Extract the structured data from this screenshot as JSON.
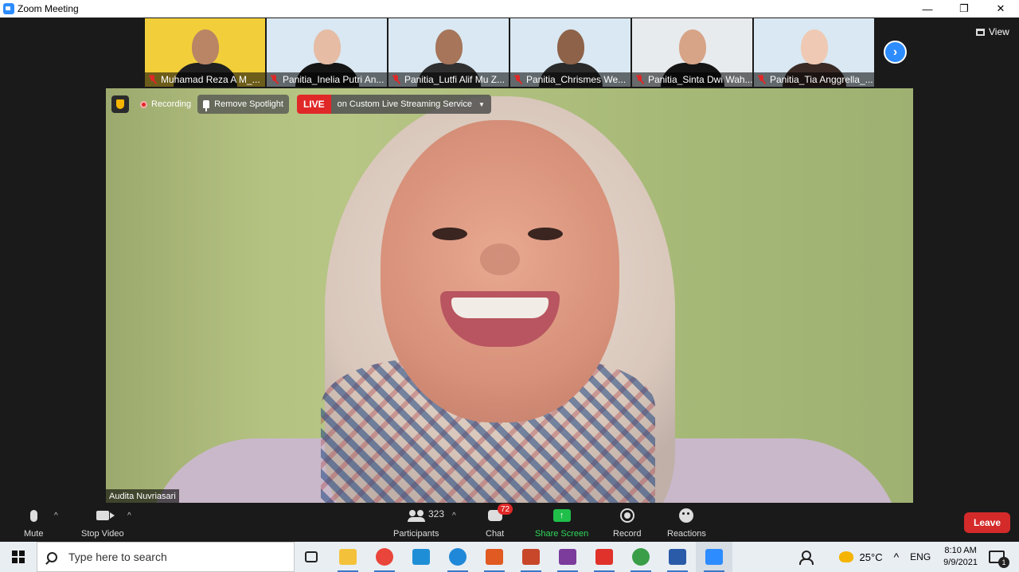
{
  "window": {
    "title": "Zoom Meeting",
    "minimize": "—",
    "restore": "❐",
    "close": "✕"
  },
  "participants_strip": [
    {
      "name": "Muhamad Reza A M_...",
      "bg": "#f2cf3a",
      "skin": "#b98565",
      "shirt": "#202020"
    },
    {
      "name": "Panitia_Inelia Putri An...",
      "bg": "#d9e8f2",
      "skin": "#e6bca4",
      "shirt": "#151515"
    },
    {
      "name": "Panitia_Lutfi Alif Mu Z...",
      "bg": "#d9e8f2",
      "skin": "#a6755a",
      "shirt": "#303030"
    },
    {
      "name": "Panitia_Chrismes We...",
      "bg": "#d9e8f2",
      "skin": "#8e6248",
      "shirt": "#2a2a2a"
    },
    {
      "name": "Panitia_Sinta Dwi Wah...",
      "bg": "#e8ebee",
      "skin": "#d7a488",
      "shirt": "#141414"
    },
    {
      "name": "Panitia_Tia Anggrella_...",
      "bg": "#d9e8f2",
      "skin": "#efc9b3",
      "shirt": "#3a2a26"
    }
  ],
  "view_label": "View",
  "next_icon": "›",
  "main": {
    "recording_label": "Recording",
    "spotlight_label": "Remove Spotlight",
    "live_tag": "LIVE",
    "live_text": "on Custom Live Streaming Service",
    "caret": "▼",
    "speaker_name": "Audita Nuvriasari"
  },
  "toolbar": {
    "mute": "Mute",
    "stop_video": "Stop Video",
    "participants": "Participants",
    "participant_count": "323",
    "chat": "Chat",
    "chat_badge": "72",
    "share_screen": "Share Screen",
    "share_arrow": "↑",
    "record": "Record",
    "reactions": "Reactions",
    "leave": "Leave",
    "caret": "^"
  },
  "taskbar": {
    "search_placeholder": "Type here to search",
    "apps": [
      {
        "name": "task-view",
        "color": "#e9eef3"
      },
      {
        "name": "file-explorer",
        "color": "#f4c23a"
      },
      {
        "name": "chrome",
        "color": "#e9453a"
      },
      {
        "name": "l-app",
        "color": "#1e8fd6"
      },
      {
        "name": "edge",
        "color": "#1f88d8"
      },
      {
        "name": "office",
        "color": "#e05a22"
      },
      {
        "name": "powerpoint",
        "color": "#c8462a"
      },
      {
        "name": "winrar",
        "color": "#7b3c9c"
      },
      {
        "name": "red-app",
        "color": "#e0322a"
      },
      {
        "name": "chrome-2",
        "color": "#3a9e48"
      },
      {
        "name": "word",
        "color": "#2a5ba8"
      },
      {
        "name": "zoom",
        "color": "#2d8cff"
      }
    ],
    "temperature": "25°C",
    "chevron": "^",
    "language": "ENG",
    "time": "8:10 AM",
    "date": "9/9/2021",
    "notification_count": "1"
  }
}
